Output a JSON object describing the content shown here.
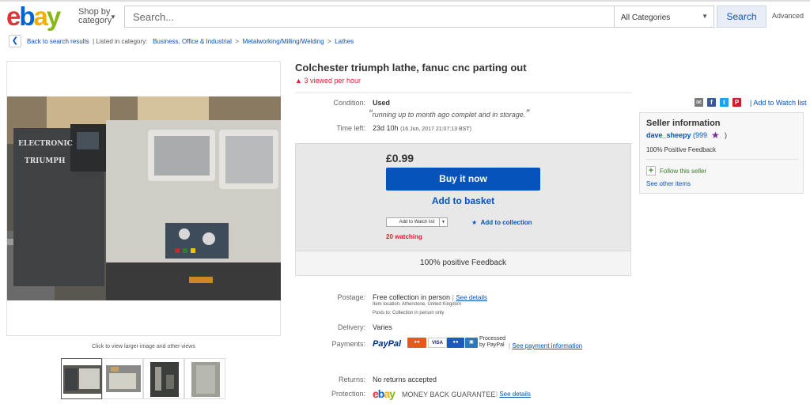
{
  "header": {
    "logo": [
      "e",
      "b",
      "a",
      "y"
    ],
    "logo_colors": [
      "#e53238",
      "#0064d2",
      "#f5af02",
      "#86b817"
    ],
    "shop_by_line1": "Shop by",
    "shop_by_line2": "category",
    "search_placeholder": "Search...",
    "category": "All Categories",
    "search_button": "Search",
    "advanced": "Advanced"
  },
  "breadcrumb": {
    "back": "Back to search results",
    "listed_in": "| Listed in category:",
    "items": [
      "Business, Office & Industrial",
      "Metalworking/Milling/Welding",
      "Lathes"
    ]
  },
  "gallery": {
    "photo_text_1": "ELECTRONIC",
    "photo_text_2": "TRIUMPH",
    "caption": "Click to view larger image and other views"
  },
  "item": {
    "title": "Colchester triumph lathe, fanuc cnc parting out",
    "viewed": "3 viewed per hour",
    "condition_label": "Condition:",
    "condition": "Used",
    "condition_quote": "running up to month ago complet and in storage.",
    "time_left_label": "Time left:",
    "time_left": "23d 10h",
    "time_left_detail": "(16 Jun, 2017   21:07:13 BST)",
    "price": "£0.99",
    "buy_now": "Buy it now",
    "add_basket": "Add to basket",
    "watch_button": "Add to Watch list",
    "add_collection": "Add to collection",
    "watching": "20 watching",
    "positive_feedback": "100% positive Feedback"
  },
  "share": {
    "icons": [
      "email-icon",
      "facebook-icon",
      "twitter-icon",
      "pinterest-icon"
    ],
    "watch_link": "| Add to Watch list"
  },
  "seller": {
    "title": "Seller information",
    "name": "dave_sheepy",
    "score": "(999",
    "close_paren": ")",
    "positive": "100% Positive Feedback",
    "follow": "Follow this seller",
    "other_items": "See other items"
  },
  "postage": {
    "label": "Postage:",
    "value": "Free collection in person",
    "see_details": "See details",
    "location": "Item location:  Atherstone, United Kingdom",
    "posts_to": "Posts to:  Collection in person only",
    "delivery_label": "Delivery:",
    "delivery": "Varies",
    "payments_label": "Payments:",
    "paypal": "PayPal",
    "visa": "VISA",
    "processed_1": "Processed",
    "processed_2": "by PayPal",
    "see_payment": "See payment information",
    "returns_label": "Returns:",
    "returns": "No returns accepted",
    "protection_label": "Protection:",
    "mbg": "MONEY BACK GUARANTEE",
    "mbg_details": "See details"
  }
}
